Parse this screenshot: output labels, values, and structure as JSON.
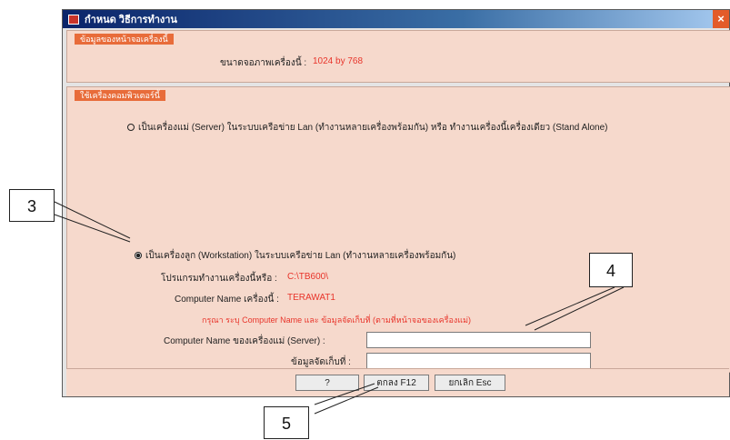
{
  "window": {
    "title": "กำหนด วิธีการทำงาน",
    "close": "×"
  },
  "group_display": {
    "header": "ข้อมูลของหน้าจอเครื่องนี้",
    "resolution_label": "ขนาดจอภาพเครื่องนี้ :",
    "resolution_value": "1024 by 768"
  },
  "group_mode": {
    "header": "ใช้เครื่องคอมพิวเตอร์นี้",
    "server_option": "เป็นเครื่องแม่ (Server) ในระบบเครือข่าย Lan (ทำงานหลายเครื่องพร้อมกัน) หรือ ทำงานเครื่องนี้เครื่องเดียว (Stand Alone)",
    "workstation_option": "เป็นเครื่องลูก (Workstation) ในระบบเครือข่าย Lan (ทำงานหลายเครื่องพร้อมกัน)",
    "program_path_label": "โปรแกรมทำงานเครื่องนี้หรือ :",
    "program_path_value": "C:\\TB600\\",
    "computer_name_label": "Computer Name เครื่องนี้ :",
    "computer_name_value": "TERAWAT1",
    "note": "กรุณา ระบุ Computer Name และ ข้อมูลจัดเก็บที่ (ตามที่หน้าจอของเครื่องแม่)",
    "server_name_label": "Computer Name ของเครื่องแม่ (Server) :",
    "server_name_value": "",
    "data_location_label": "ข้อมูลจัดเก็บที่ :",
    "data_location_value": ""
  },
  "buttons": {
    "help": "?",
    "ok": "ตกลง F12",
    "cancel": "ยกเลิก Esc"
  },
  "callouts": {
    "c3": "3",
    "c4": "4",
    "c5": "5"
  },
  "colors": {
    "accent": "#e86c3a",
    "value_red": "#e8342a",
    "panel": "#f6d9cc"
  }
}
